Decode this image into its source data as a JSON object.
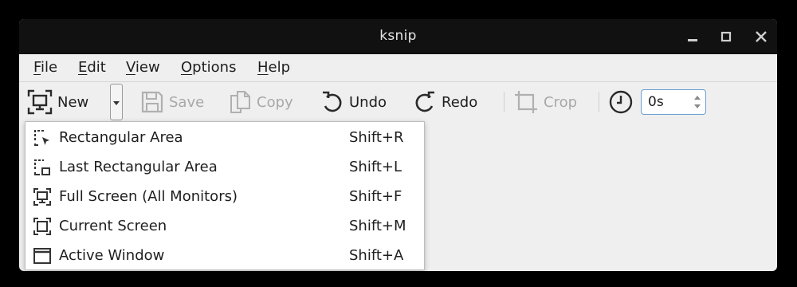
{
  "window": {
    "title": "ksnip"
  },
  "menubar": {
    "items": [
      {
        "mnemonic": "F",
        "rest": "ile"
      },
      {
        "mnemonic": "E",
        "rest": "dit"
      },
      {
        "mnemonic": "V",
        "rest": "iew"
      },
      {
        "mnemonic": "O",
        "rest": "ptions"
      },
      {
        "mnemonic": "H",
        "rest": "elp"
      }
    ]
  },
  "toolbar": {
    "new_label": "New",
    "save_label": "Save",
    "copy_label": "Copy",
    "undo_label": "Undo",
    "redo_label": "Redo",
    "crop_label": "Crop",
    "delay_value": "0s"
  },
  "capture_menu": {
    "items": [
      {
        "label": "Rectangular Area",
        "shortcut": "Shift+R",
        "icon": "rectangular-area-icon"
      },
      {
        "label": "Last Rectangular Area",
        "shortcut": "Shift+L",
        "icon": "last-rectangular-area-icon"
      },
      {
        "label": "Full Screen (All Monitors)",
        "shortcut": "Shift+F",
        "icon": "full-screen-icon"
      },
      {
        "label": "Current Screen",
        "shortcut": "Shift+M",
        "icon": "current-screen-icon"
      },
      {
        "label": "Active Window",
        "shortcut": "Shift+A",
        "icon": "active-window-icon"
      }
    ]
  },
  "colors": {
    "background": "#000000",
    "titlebar": "#111111",
    "window": "#efefef",
    "text": "#1e1e1e",
    "disabled_text": "#a8a8a8",
    "focus": "#6a9fd4"
  }
}
